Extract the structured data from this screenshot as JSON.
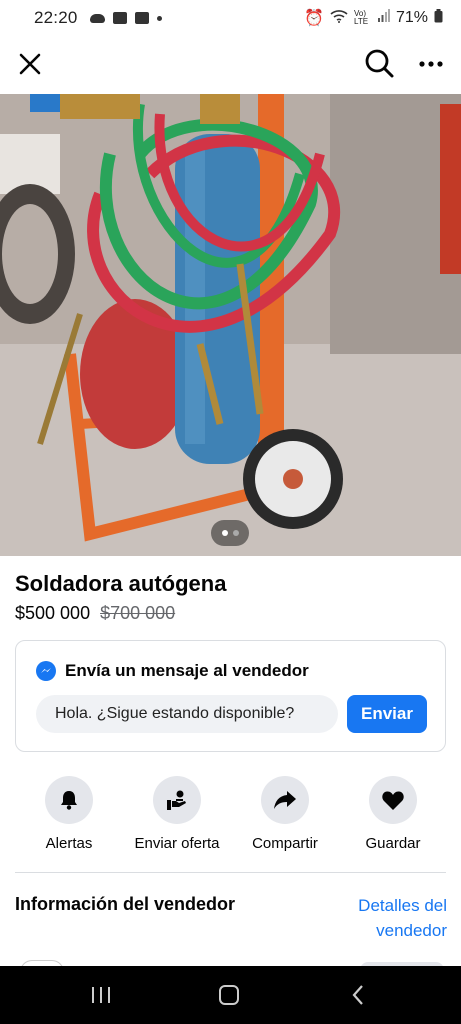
{
  "status_bar": {
    "time": "22:20",
    "battery": "71%",
    "network": "Vo) LTE"
  },
  "nav": {
    "close_icon": "close-icon",
    "search_icon": "search-icon",
    "more_icon": "more-horizontal-icon"
  },
  "listing": {
    "title": "Soldadora autógena",
    "price": "$500 000",
    "old_price": "$700 000",
    "photo_count": 2,
    "current_photo": 1
  },
  "message": {
    "heading": "Envía un mensaje al vendedor",
    "input_value": "Hola. ¿Sigue estando disponible?",
    "send_label": "Enviar"
  },
  "actions": [
    {
      "label": "Alertas",
      "icon": "bell-icon"
    },
    {
      "label": "Enviar oferta",
      "icon": "offer-icon"
    },
    {
      "label": "Compartir",
      "icon": "share-icon"
    },
    {
      "label": "Guardar",
      "icon": "heart-icon"
    }
  ],
  "seller": {
    "heading": "Información del vendedor",
    "details_link": "Detalles del vendedor"
  },
  "colors": {
    "accent": "#1877f2",
    "chip_bg": "#e4e6eb",
    "input_bg": "#f0f2f5"
  }
}
